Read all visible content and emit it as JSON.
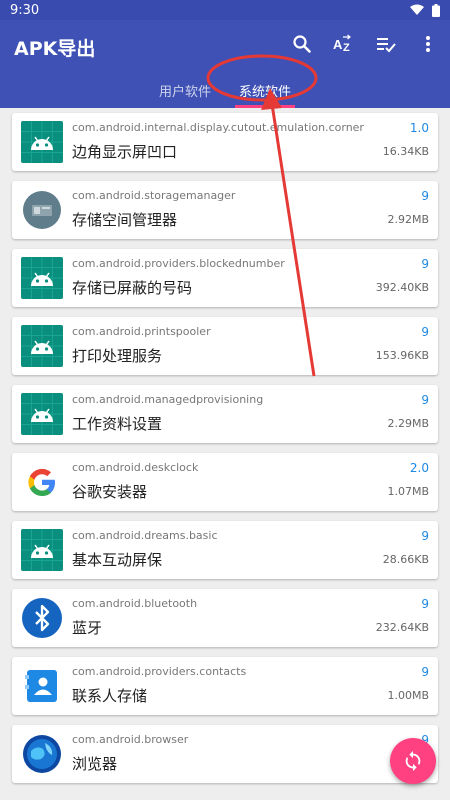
{
  "status": {
    "time": "9:30"
  },
  "appbar": {
    "title": "APK导出"
  },
  "tabs": [
    {
      "label": "用户软件"
    },
    {
      "label": "系统软件"
    }
  ],
  "apps": [
    {
      "package": "com.android.internal.display.cutout.emulation.corner",
      "name": "边角显示屏凹口",
      "version": "1.0",
      "size": "16.34KB",
      "icon": "android-icon"
    },
    {
      "package": "com.android.storagemanager",
      "name": "存储空间管理器",
      "version": "9",
      "size": "2.92MB",
      "icon": "storage-icon"
    },
    {
      "package": "com.android.providers.blockednumber",
      "name": "存储已屏蔽的号码",
      "version": "9",
      "size": "392.40KB",
      "icon": "android-icon"
    },
    {
      "package": "com.android.printspooler",
      "name": "打印处理服务",
      "version": "9",
      "size": "153.96KB",
      "icon": "android-icon"
    },
    {
      "package": "com.android.managedprovisioning",
      "name": "工作资料设置",
      "version": "9",
      "size": "2.29MB",
      "icon": "android-icon"
    },
    {
      "package": "com.android.deskclock",
      "name": "谷歌安装器",
      "version": "2.0",
      "size": "1.07MB",
      "icon": "google-icon"
    },
    {
      "package": "com.android.dreams.basic",
      "name": "基本互动屏保",
      "version": "9",
      "size": "28.66KB",
      "icon": "android-icon"
    },
    {
      "package": "com.android.bluetooth",
      "name": "蓝牙",
      "version": "9",
      "size": "232.64KB",
      "icon": "bluetooth-icon"
    },
    {
      "package": "com.android.providers.contacts",
      "name": "联系人存储",
      "version": "9",
      "size": "1.00MB",
      "icon": "contacts-icon"
    },
    {
      "package": "com.android.browser",
      "name": "浏览器",
      "version": "9",
      "size": "",
      "icon": "browser-icon"
    }
  ],
  "colors": {
    "primary": "#3f51b5",
    "accent": "#ff4081",
    "version": "#1e88e5"
  }
}
